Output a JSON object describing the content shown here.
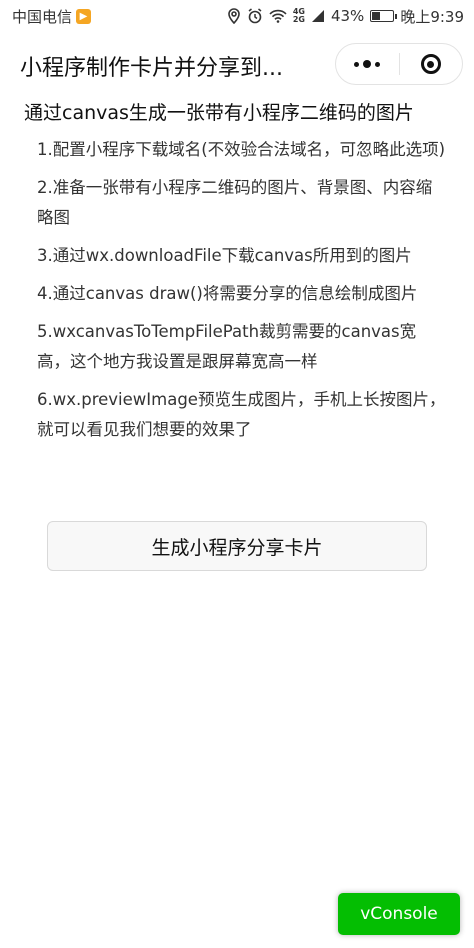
{
  "status_bar": {
    "carrier": "中国电信",
    "battery_percent": "43%",
    "battery_level": 0.43,
    "time": "晚上9:39",
    "net_4g": "4G",
    "net_2g": "2G"
  },
  "nav": {
    "title": "小程序制作卡片并分享到..."
  },
  "content": {
    "heading": "通过canvas生成一张带有小程序二维码的图片",
    "steps": [
      "1.配置小程序下载域名(不效验合法域名，可忽略此选项)",
      "2.准备一张带有小程序二维码的图片、背景图、内容缩略图",
      "3.通过wx.downloadFile下载canvas所用到的图片",
      "4.通过canvas draw()将需要分享的信息绘制成图片",
      "5.wxcanvasToTempFilePath裁剪需要的canvas宽高，这个地方我设置是跟屏幕宽高一样",
      "6.wx.previewImage预览生成图片，手机上长按图片，就可以看见我们想要的效果了"
    ],
    "button_label": "生成小程序分享卡片"
  },
  "vconsole": {
    "label": "vConsole"
  },
  "colors": {
    "vconsole_green": "#04be02",
    "carrier_badge": "#f5a623"
  }
}
